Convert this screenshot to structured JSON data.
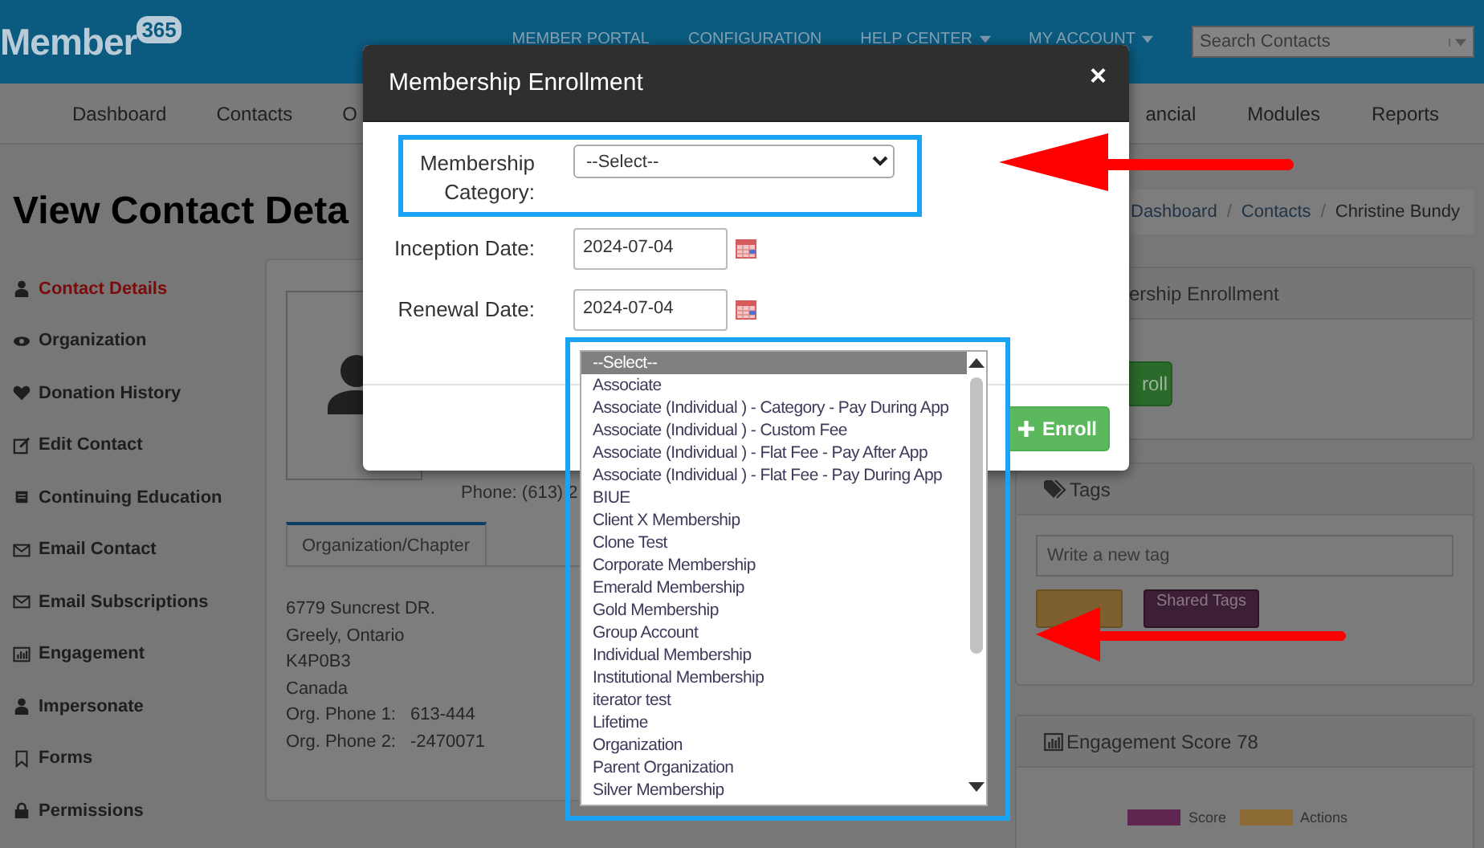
{
  "header": {
    "logo_word": "Member",
    "logo_badge": "365",
    "top_links": [
      {
        "label": "MEMBER PORTAL",
        "has_menu": false
      },
      {
        "label": "CONFIGURATION",
        "has_menu": false
      },
      {
        "label": "HELP CENTER",
        "has_menu": true
      },
      {
        "label": "MY ACCOUNT",
        "has_menu": true
      }
    ],
    "search": {
      "placeholder": "Search Contacts"
    }
  },
  "nav": {
    "left": [
      "Dashboard",
      "Contacts",
      "O"
    ],
    "right": [
      "ancial",
      "Modules",
      "Reports"
    ]
  },
  "page_title": "View Contact Deta",
  "sidebar": [
    {
      "label": "Contact Details",
      "selected": true
    },
    {
      "label": "Organization",
      "selected": false
    },
    {
      "label": "Donation History",
      "selected": false
    },
    {
      "label": "Edit Contact",
      "selected": false
    },
    {
      "label": "Continuing Education",
      "selected": false
    },
    {
      "label": "Email Contact",
      "selected": false
    },
    {
      "label": "Email Subscriptions",
      "selected": false
    },
    {
      "label": "Engagement",
      "selected": false
    },
    {
      "label": "Impersonate",
      "selected": false
    },
    {
      "label": "Forms",
      "selected": false
    },
    {
      "label": "Permissions",
      "selected": false
    }
  ],
  "contact": {
    "phone": "Phone: (613) 2",
    "tab": "Organization/Chapter",
    "address": [
      "6779 Suncrest DR.",
      "Greely, Ontario",
      "K4P0B3",
      "Canada"
    ],
    "org_phones": [
      {
        "label": "Org. Phone 1:",
        "value": "613-444"
      },
      {
        "label": "Org. Phone 2:",
        "value": "-2470071"
      }
    ]
  },
  "breadcrumb": {
    "separator": "/",
    "items": [
      "Dashboard",
      "Contacts",
      "Christine Bundy"
    ]
  },
  "enrollment_panel": {
    "title": "ership Enrollment",
    "button": "roll"
  },
  "tags_panel": {
    "title": "Tags",
    "placeholder": "Write a new tag",
    "shared_button": "Shared Tags"
  },
  "engagement_panel": {
    "title": "Engagement Score 78",
    "legend": [
      {
        "label": "Score",
        "color": "#5e2650"
      },
      {
        "label": "Actions",
        "color": "#8c6a34"
      }
    ]
  },
  "modal": {
    "title": "Membership Enrollment",
    "close": "×",
    "fields": [
      {
        "label": "Membership Category:",
        "kind": "select",
        "value": "--Select--"
      },
      {
        "label": "Inception Date:",
        "kind": "date",
        "value": "2024-07-04"
      },
      {
        "label": "Renewal Date:",
        "kind": "date",
        "value": "2024-07-04"
      }
    ],
    "button": "Enroll"
  },
  "dropdown": {
    "options": [
      {
        "label": "--Select--",
        "selected": true
      },
      {
        "label": "Associate",
        "selected": false
      },
      {
        "label": "Associate (Individual ) - Category - Pay During App",
        "selected": false
      },
      {
        "label": "Associate (Individual ) - Custom Fee",
        "selected": false
      },
      {
        "label": "Associate (Individual ) - Flat Fee - Pay After App",
        "selected": false
      },
      {
        "label": "Associate (Individual ) - Flat Fee - Pay During App",
        "selected": false
      },
      {
        "label": "BIUE",
        "selected": false
      },
      {
        "label": "Client X Membership",
        "selected": false
      },
      {
        "label": "Clone Test",
        "selected": false
      },
      {
        "label": "Corporate Membership",
        "selected": false
      },
      {
        "label": "Emerald Membership",
        "selected": false
      },
      {
        "label": "Gold Membership",
        "selected": false
      },
      {
        "label": "Group Account",
        "selected": false
      },
      {
        "label": "Individual Membership",
        "selected": false
      },
      {
        "label": "Institutional Membership",
        "selected": false
      },
      {
        "label": "iterator test",
        "selected": false
      },
      {
        "label": "Lifetime",
        "selected": false
      },
      {
        "label": "Organization",
        "selected": false
      },
      {
        "label": "Parent Organization",
        "selected": false
      },
      {
        "label": "Silver Membership",
        "selected": false
      }
    ]
  }
}
